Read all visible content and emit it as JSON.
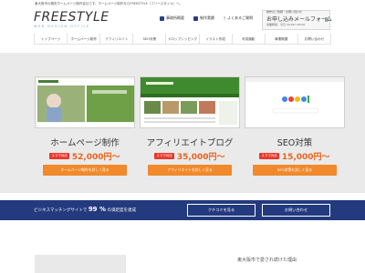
{
  "tagline": "東大阪市の格安ホームページ制作会社です。ホームページ制作ならFREESTYLE（フリースタイル）へ。",
  "logo": {
    "main": "FREESTYLE",
    "sub": "WEB DESIGN OFFICE"
  },
  "top_links": [
    {
      "label": "事務所概要"
    },
    {
      "label": "制作実績"
    },
    {
      "label": "よくあるご質問"
    }
  ],
  "contact": {
    "small": "制作のご依頼・お問い合わせ",
    "title": "お申し込みメールフォーム",
    "hours": "営業時間：平日 10:00～18:00"
  },
  "nav": [
    "トップページ",
    "ホームページ制作",
    "アフィリエイト",
    "SEO対策",
    "ドロップシッピング",
    "イラスト作成",
    "写真撮影",
    "事業概要",
    "お問い合わせ"
  ],
  "cards": [
    {
      "title": "ホームページ制作",
      "badge": "スマホ対応",
      "price": "52,000円～",
      "button": "ホームページ制作を詳しく見る"
    },
    {
      "title": "アフィリエイトブログ",
      "badge": "スマホ対応",
      "price": "35,000円～",
      "button": "アフィリエイトを詳しく見る"
    },
    {
      "title": "SEO対策",
      "badge": "スマホ対応",
      "price": "15,000円～",
      "button": "SEO対策を詳しく見る"
    }
  ],
  "banner": {
    "text_before": "ビジネスマッチングサイトで",
    "percent": "99 %",
    "text_after": "の満足度を達成",
    "btn_1": "クチコミを見る",
    "btn_2": "お問い合わせ"
  },
  "bottom": {
    "caption": "東大阪市で愛され続けた理由"
  },
  "colors": {
    "navy": "#233a7e",
    "orange": "#f08a2c",
    "red": "#e8382b",
    "price": "#e8631c"
  }
}
